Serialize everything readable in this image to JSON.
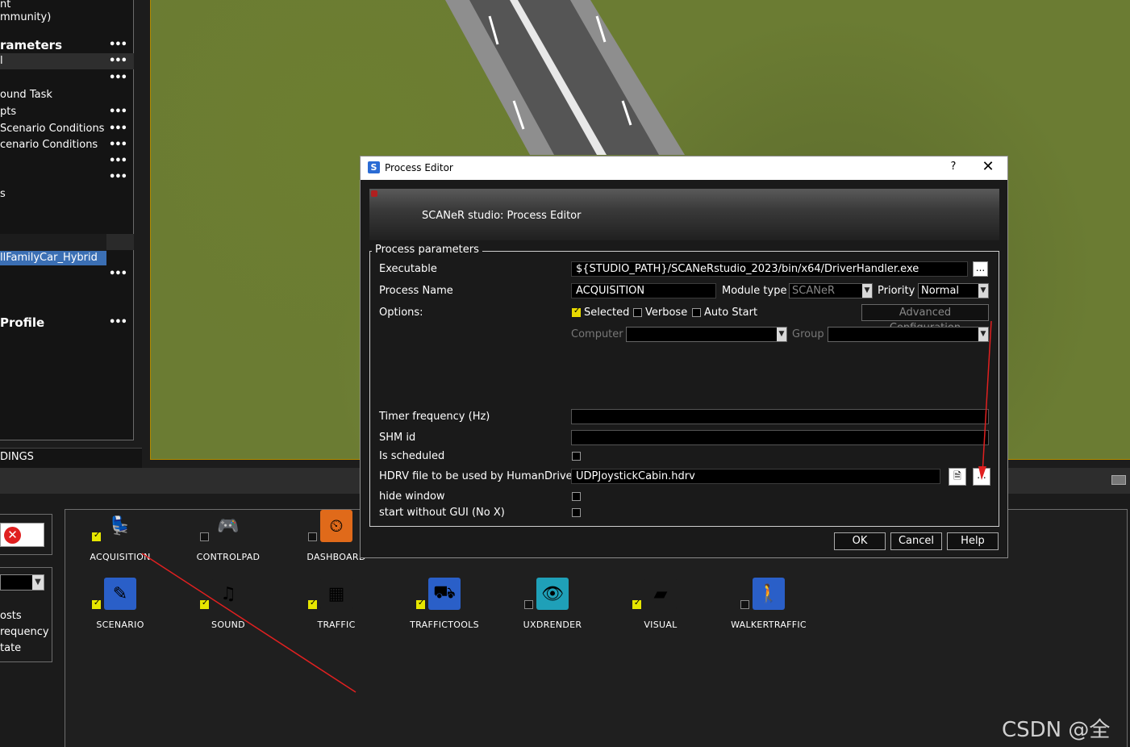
{
  "left_panel": {
    "items": [
      {
        "label": "nt",
        "dots": false
      },
      {
        "label": "mmunity)",
        "dots": false
      },
      {
        "label": "rameters",
        "dots": true,
        "bold": true
      },
      {
        "label": "l",
        "dots": true,
        "selected": true
      },
      {
        "label": "",
        "dots": true
      },
      {
        "label": "ound Task",
        "dots": false
      },
      {
        "label": "pts",
        "dots": true
      },
      {
        "label": "Scenario Conditions",
        "dots": true
      },
      {
        "label": "cenario Conditions",
        "dots": true
      },
      {
        "label": "",
        "dots": true
      },
      {
        "label": "",
        "dots": true
      },
      {
        "label": "s",
        "dots": false
      }
    ],
    "dots_label": "•••",
    "highlighted_item": "llFamilyCar_Hybrid",
    "extra_dots": "•••",
    "profile_label": "Profile",
    "profile_dots": "•••",
    "bindings_label": "DINGS"
  },
  "left_lower": {
    "close_icon": "✕",
    "lines": [
      "osts",
      "requency",
      "tate"
    ]
  },
  "modules": [
    {
      "name": "ACQUISITION",
      "checked": true,
      "icon": "seat-icon",
      "glyph": "💺",
      "color": "#1f1f1f"
    },
    {
      "name": "CONTROLPAD",
      "checked": false,
      "icon": "controlpad-icon",
      "glyph": "🎮",
      "color": "#1f1f1f"
    },
    {
      "name": "DASHBOARD",
      "checked": false,
      "icon": "gauge-icon",
      "glyph": "⏲",
      "color": "#e06a1a"
    },
    {
      "name": "SCENARIO",
      "checked": true,
      "icon": "scenario-icon",
      "glyph": "✎",
      "color": "#2a5fc8"
    },
    {
      "name": "SOUND",
      "checked": true,
      "icon": "sound-icon",
      "glyph": "♫",
      "color": "#1f1f1f"
    },
    {
      "name": "TRAFFIC",
      "checked": true,
      "icon": "traffic-icon",
      "glyph": "▦",
      "color": "#1f1f1f"
    },
    {
      "name": "TRAFFICTOOLS",
      "checked": true,
      "icon": "traffictools-icon",
      "glyph": "⛟",
      "color": "#2a5fc8"
    },
    {
      "name": "UXDRENDER",
      "checked": false,
      "icon": "eye-icon",
      "glyph": "👁",
      "color": "#1fa0b8"
    },
    {
      "name": "VISUAL",
      "checked": true,
      "icon": "visual-icon",
      "glyph": "▰",
      "color": "#1f1f1f"
    },
    {
      "name": "WALKERTRAFFIC",
      "checked": false,
      "icon": "walker-icon",
      "glyph": "🚶",
      "color": "#2a5fc8"
    }
  ],
  "dialog": {
    "title": "Process Editor",
    "help": "?",
    "close": "✕",
    "app_icon": "S",
    "banner_text": "SCANeR studio: Process Editor",
    "group_title": "Process parameters",
    "executable_label": "Executable",
    "executable_value": "${STUDIO_PATH}/SCANeRstudio_2023/bin/x64/DriverHandler.exe",
    "browse": "...",
    "process_name_label": "Process Name",
    "process_name_value": "ACQUISITION",
    "module_type_label": "Module type",
    "module_type_value": "SCANeR",
    "priority_label": "Priority",
    "priority_value": "Normal",
    "options_label": "Options:",
    "selected_label": "Selected",
    "verbose_label": "Verbose",
    "autostart_label": "Auto Start",
    "advanced_label": "Advanced Configuration",
    "computer_label": "Computer",
    "group_label": "Group",
    "timer_label": "Timer frequency (Hz)",
    "shm_label": "SHM id",
    "scheduled_label": "Is scheduled",
    "hdrv_label": "HDRV file to be used by HumanDriver",
    "hdrv_value": "UDPJoystickCabin.hdrv",
    "hide_label": "hide window",
    "nogui_label": "start without GUI (No X)",
    "ok": "OK",
    "cancel": "Cancel",
    "help_btn": "Help",
    "options": {
      "selected": true,
      "verbose": false,
      "autostart": false
    }
  },
  "watermark": "CSDN @全栈",
  "colors": {
    "accent": "#3b6fb4",
    "viewport_border": "#b48a00",
    "annotation": "#e02020"
  }
}
